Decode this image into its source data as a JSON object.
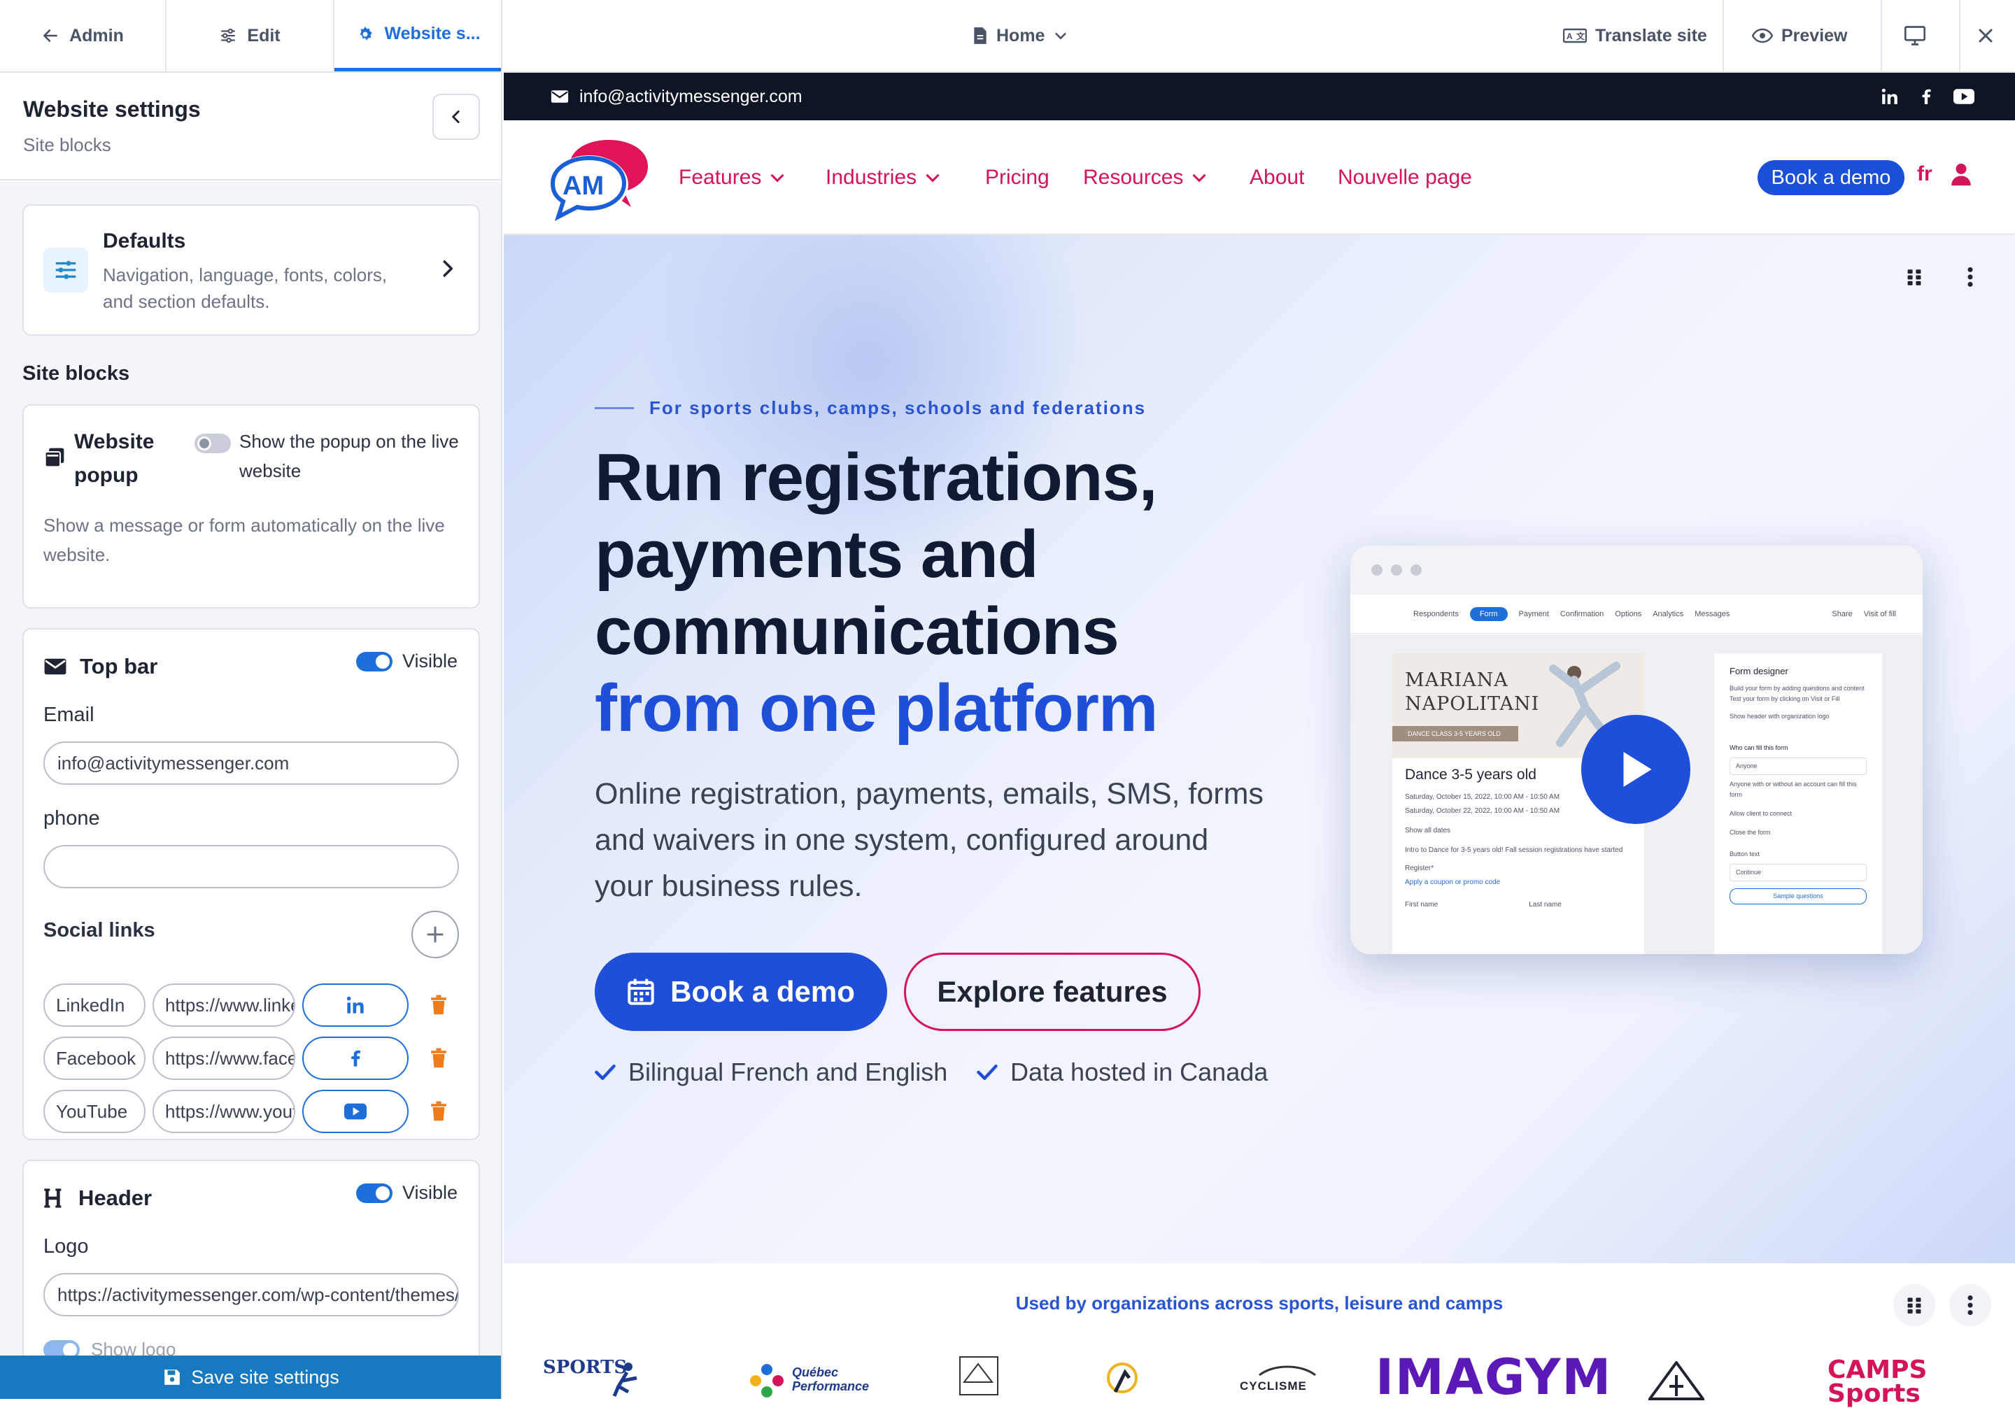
{
  "editor": {
    "tabs": [
      {
        "label": "Admin",
        "icon": "arrow-left-icon"
      },
      {
        "label": "Edit",
        "icon": "sliders-icon"
      },
      {
        "label": "Website s...",
        "icon": "gear-icon"
      }
    ],
    "panel_title": "Website settings",
    "panel_subtitle": "Site blocks",
    "defaults": {
      "title": "Defaults",
      "description": "Navigation, language, fonts, colors, and section defaults."
    },
    "site_blocks_title": "Site blocks",
    "popup": {
      "title": "Website popup",
      "toggle_label": "Show the popup on the live website",
      "description": "Show a message or form automatically on the live website."
    },
    "top_bar": {
      "title": "Top bar",
      "visible_label": "Visible",
      "email_label": "Email",
      "email_value": "info@activitymessenger.com",
      "phone_label": "phone",
      "phone_value": "",
      "social_title": "Social links",
      "socials": [
        {
          "name": "LinkedIn",
          "url": "https://www.linkedin.com",
          "icon": "linkedin-icon"
        },
        {
          "name": "Facebook",
          "url": "https://www.facebook.com",
          "icon": "facebook-icon"
        },
        {
          "name": "YouTube",
          "url": "https://www.youtube.com",
          "icon": "youtube-icon"
        }
      ]
    },
    "header": {
      "title": "Header",
      "visible_label": "Visible",
      "logo_label": "Logo",
      "logo_value": "https://activitymessenger.com/wp-content/themes/am/logo.svg",
      "show_logo_label": "Show logo"
    },
    "save_label": "Save site settings"
  },
  "chrome": {
    "page_selector": "Home",
    "translate_label": "Translate site",
    "preview_label": "Preview"
  },
  "site": {
    "topbar_email": "info@activitymessenger.com",
    "logo_text": "AM",
    "nav": [
      {
        "label": "Features",
        "dropdown": true
      },
      {
        "label": "Industries",
        "dropdown": true
      },
      {
        "label": "Pricing",
        "dropdown": false
      },
      {
        "label": "Resources",
        "dropdown": true
      },
      {
        "label": "About",
        "dropdown": false
      },
      {
        "label": "Nouvelle page",
        "dropdown": false
      }
    ],
    "nav_cta": "Book a demo",
    "lang": "fr",
    "hero": {
      "eyebrow": "For sports clubs, camps, schools and federations",
      "h1_line1": "Run registrations,",
      "h1_line2": "payments and",
      "h1_line3": "communications",
      "h1_highlight": "from one platform",
      "lead": "Online registration, payments, emails, SMS, forms and waivers in one system, configured around your business rules.",
      "cta_primary": "Book a demo",
      "cta_secondary": "Explore features",
      "checks": [
        "Bilingual French and English",
        "Data hosted in Canada"
      ]
    },
    "screenshot": {
      "tabs": [
        "Respondents",
        "Form",
        "Payment",
        "Confirmation",
        "Options",
        "Analytics",
        "Messages"
      ],
      "share": "Share",
      "visit": "Visit of fill",
      "event_name": "MARIANA NAPOLITANI",
      "event_tag": "DANCE CLASS 3-5 YEARS OLD",
      "event_title": "Dance 3-5 years old",
      "date1": "Saturday, October 15, 2022, 10:00 AM - 10:50 AM",
      "date2": "Saturday, October 22, 2022, 10:00 AM - 10:50 AM",
      "show_all": "Show all dates",
      "intro": "Intro to Dance for 3-5 years old! Fall session registrations have started",
      "register": "Register*",
      "promo": "Apply a coupon or promo code",
      "first_name": "First name",
      "last_name": "Last name",
      "designer_title": "Form designer",
      "designer_b1": "Build your form by adding questions and content",
      "designer_b2": "Test your form by clicking on Visit or Fill",
      "designer_opt": "Show header with organization logo",
      "who_fill": "Who can fill this form",
      "anyone": "Anyone",
      "anyone_note": "Anyone with or without an account can fill this form",
      "allow_connect": "Allow client to connect",
      "close_form": "Close the form",
      "button_text": "Button text",
      "continue": "Continue",
      "sample": "Sample questions"
    },
    "used_by": "Used by organizations across sports, leisure and camps",
    "partner_logos": [
      "SPORTS",
      "Québec Performance",
      "CYCLISME",
      "IMAGYM",
      "CAMPS Sports"
    ]
  },
  "colors": {
    "accent_blue": "#1f4fd8",
    "editor_blue": "#1e6fd9",
    "brand_pink": "#d4145a",
    "dark": "#0e1626"
  }
}
